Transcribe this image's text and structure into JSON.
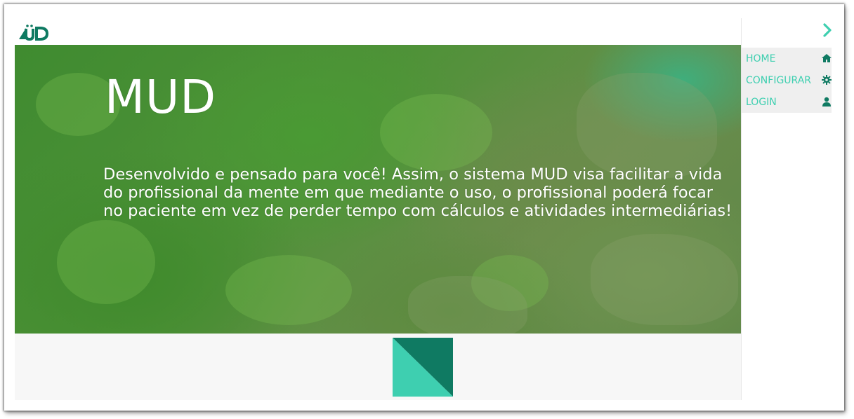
{
  "header": {
    "logo_icon": "mud-logo-icon"
  },
  "hero": {
    "title": "MUD",
    "description": "Desenvolvido e pensado para você! Assim, o sistema MUD visa facilitar a vida do profissional da mente em que mediante o uso, o profissional poderá focar no paciente em vez de perder tempo com cálculos e atividades intermediárias!"
  },
  "sidebar": {
    "toggle_icon": "chevron-right-icon",
    "items": [
      {
        "label": "HOME",
        "icon": "home-icon"
      },
      {
        "label": "CONFIGURAR",
        "icon": "gear-icon"
      },
      {
        "label": "LOGIN",
        "icon": "user-icon"
      }
    ]
  },
  "footer": {
    "mark_icon": "m-brand-icon"
  },
  "colors": {
    "accent": "#3ecfb0",
    "accent_dark": "#0f7a62",
    "hero_overlay": "#4f9238"
  }
}
